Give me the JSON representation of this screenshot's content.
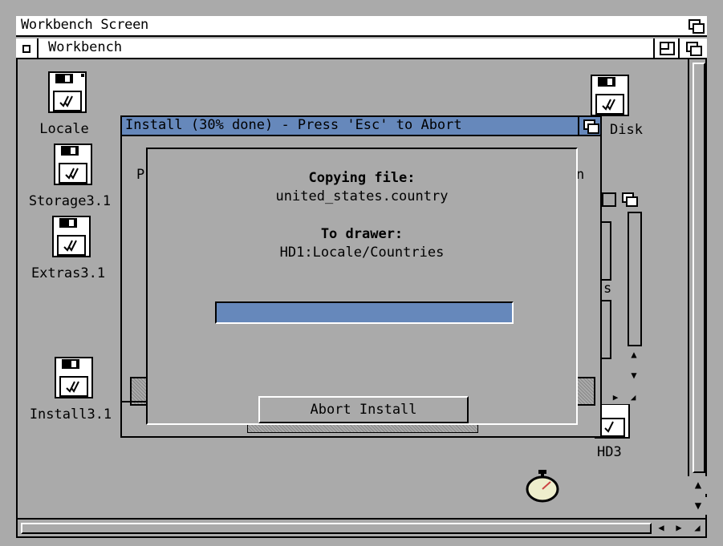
{
  "screen": {
    "title": "Workbench Screen"
  },
  "workbench_window": {
    "title": "Workbench"
  },
  "desktop_icons": [
    {
      "label": "Locale"
    },
    {
      "label": "Storage3.1"
    },
    {
      "label": "Extras3.1"
    },
    {
      "label": "Install3.1"
    },
    {
      "label": "Disk"
    },
    {
      "label": "HD3"
    }
  ],
  "partial_texts": {
    "left": "P",
    "right": "n",
    "drawer_s": "s"
  },
  "install_dialog": {
    "title": "Install (30% done) - Press 'Esc' to Abort",
    "copying_label": "Copying file:",
    "file_name": "united_states.country",
    "drawer_label": "To drawer:",
    "drawer_path": "HD1:Locale/Countries",
    "progress": 0.3,
    "abort_label": "Abort Install"
  },
  "colors": {
    "background": "#aaaaaa",
    "accent": "#6688bb",
    "white": "#ffffff",
    "black": "#000000"
  },
  "icons": [
    "depth-gadget-icon",
    "close-gadget-icon",
    "zoom-gadget-icon",
    "disk-icon",
    "stopwatch-icon",
    "arrow-up-icon",
    "arrow-down-icon",
    "arrow-left-icon",
    "arrow-right-icon",
    "resize-icon"
  ]
}
